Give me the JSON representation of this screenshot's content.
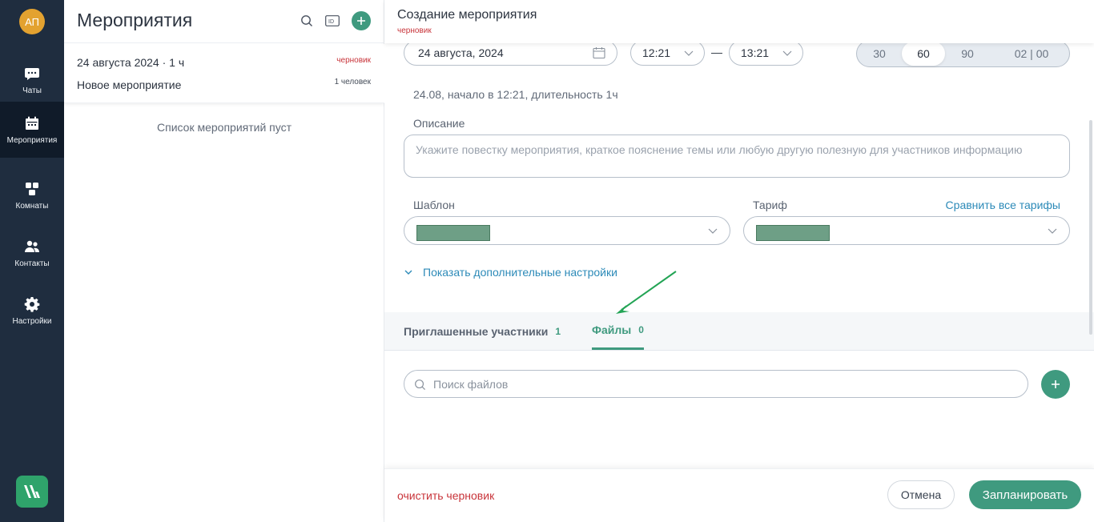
{
  "colors": {
    "accent": "#3f9a7f",
    "rail_bg": "#1f2d3f",
    "rail_active_bg": "#101b29",
    "draft_red": "#c8343a",
    "link_blue": "#2c8ab8",
    "avatar_bg": "#e3a230",
    "annotation_arrow": "#23a455"
  },
  "rail": {
    "avatar_initials": "АП",
    "items": [
      {
        "label": "Чаты",
        "icon": "chat-icon"
      },
      {
        "label": "Мероприятия",
        "icon": "calendar-icon",
        "active": true
      },
      {
        "label": "Комнаты",
        "icon": "rooms-icon"
      },
      {
        "label": "Контакты",
        "icon": "contacts-icon"
      },
      {
        "label": "Настройки",
        "icon": "gear-icon"
      }
    ],
    "logo_icon": "app-logo-icon"
  },
  "list": {
    "title": "Мероприятия",
    "header_icons": [
      "search-icon",
      "id-icon",
      "plus-icon"
    ],
    "card": {
      "date": "24 августа 2024 · 1 ч",
      "status": "черновик",
      "name": "Новое мероприятие",
      "participants": "1 человек"
    },
    "empty_text": "Список мероприятий пуст"
  },
  "form": {
    "title": "Создание мероприятия",
    "status": "черновик",
    "date_value": "24 августа, 2024",
    "time_start": "12:21",
    "time_separator": "—",
    "time_end": "13:21",
    "durations": [
      "30",
      "60",
      "90",
      "02 | 00"
    ],
    "selected_duration": "60",
    "summary": "24.08, начало в 12:21, длительность 1ч",
    "description_label": "Описание",
    "description_placeholder": "Укажите повестку мероприятия, краткое пояснение темы или любую другую полезную для участников информацию",
    "template_label": "Шаблон",
    "tariff_label": "Тариф",
    "compare_link": "Сравнить все тарифы",
    "more_settings": "Показать дополнительные настройки"
  },
  "tabs": [
    {
      "label": "Приглашенные участники",
      "count": "1"
    },
    {
      "label": "Файлы",
      "count": "0",
      "active": true
    }
  ],
  "files": {
    "search_placeholder": "Поиск файлов"
  },
  "footer": {
    "clear_draft": "очистить черновик",
    "cancel": "Отмена",
    "schedule": "Запланировать"
  }
}
